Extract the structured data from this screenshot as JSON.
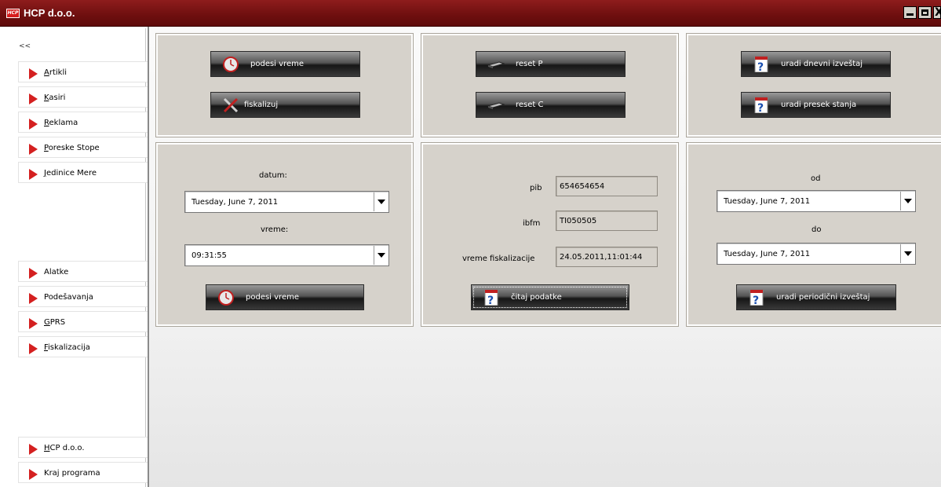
{
  "window": {
    "title": "HCP d.o.o.",
    "logo_text": "HCP"
  },
  "sidebar": {
    "collapse_label": "<<",
    "top_items": [
      {
        "label": "Artikli"
      },
      {
        "label": "Kasiri"
      },
      {
        "label": "Reklama"
      },
      {
        "label": "Poreske Stope"
      },
      {
        "label": "Jedinice Mere"
      }
    ],
    "mid_items": [
      {
        "label": "Alatke"
      },
      {
        "label": "Podešavanja"
      },
      {
        "label": "GPRS"
      },
      {
        "label": "Fiskalizacija"
      }
    ],
    "bottom_items": [
      {
        "label": "HCP d.o.o."
      },
      {
        "label": "Kraj programa"
      }
    ]
  },
  "panels": {
    "time": {
      "set_time_label": "podesi vreme",
      "fiscalize_label": "fiskalizuj"
    },
    "reset": {
      "reset_p_label": "reset P",
      "reset_c_label": "reset C"
    },
    "reports": {
      "daily_label": "uradi dnevni izveštaj",
      "snapshot_label": "uradi presek stanja"
    },
    "datetime": {
      "date_label": "datum:",
      "date_value": "Tuesday, June 7, 2011",
      "time_label": "vreme:",
      "time_value": "09:31:55",
      "set_time_label": "podesi vreme"
    },
    "info": {
      "pib_label": "pib",
      "pib_value": "654654654",
      "ibfm_label": "ibfm",
      "ibfm_value": "TI050505",
      "fisc_time_label": "vreme fiskalizacije",
      "fisc_time_value": "24.05.2011,11:01:44",
      "read_label": "čitaj podatke"
    },
    "period": {
      "from_label": "od",
      "from_value": "Tuesday, June 7, 2011",
      "to_label": "do",
      "to_value": "Tuesday, June 7, 2011",
      "report_label": "uradi periodični izveštaj"
    }
  },
  "icons": {
    "clock": "clock-icon",
    "tools": "tools-icon",
    "device": "fiscal-device-icon",
    "help": "help-document-icon"
  },
  "colors": {
    "titlebar": "#7a1414",
    "accent_red": "#d42020",
    "panel_bg": "#d6d2cb"
  }
}
